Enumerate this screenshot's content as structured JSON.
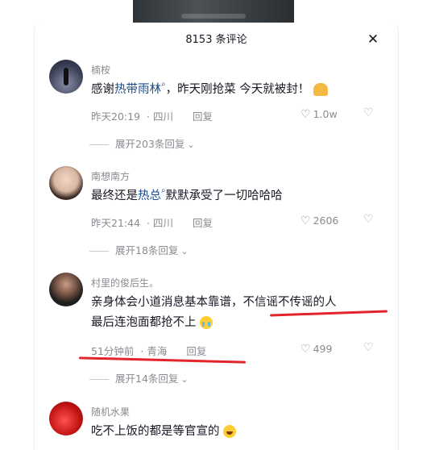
{
  "header": {
    "title": "8153 条评论",
    "close_label": "✕"
  },
  "comments": [
    {
      "user": "楠桉",
      "text_before": "感谢",
      "highlight": "热带雨林",
      "text_after": "，昨天刚抢菜 今天就被封！",
      "time": "昨天20:19",
      "location": "四川",
      "reply": "回复",
      "likes": "1.0w",
      "expand": "展开203条回复"
    },
    {
      "user": "南想南方",
      "text_before": "最终还是",
      "highlight": "热总",
      "text_after": "默默承受了一切哈哈哈",
      "time": "昨天21:44",
      "location": "四川",
      "reply": "回复",
      "likes": "2606",
      "expand": "展开18条回复"
    },
    {
      "user": "村里的俊后生。",
      "line1": "亲身体会小道消息基本靠谱，不信谣不传谣的人",
      "line2": "最后连泡面都抢不上",
      "time": "51分钟前",
      "location": "青海",
      "reply": "回复",
      "likes": "499",
      "expand": "展开14条回复"
    },
    {
      "user": "随机水果",
      "text": "吃不上饭的都是等官宣的"
    }
  ],
  "icons": {
    "search_mark": "⌕",
    "heart": "♡",
    "dislike": "♡",
    "chevron": "⌄"
  },
  "colors": {
    "highlight": "#1a4b8c",
    "annotation": "#e2252c"
  }
}
